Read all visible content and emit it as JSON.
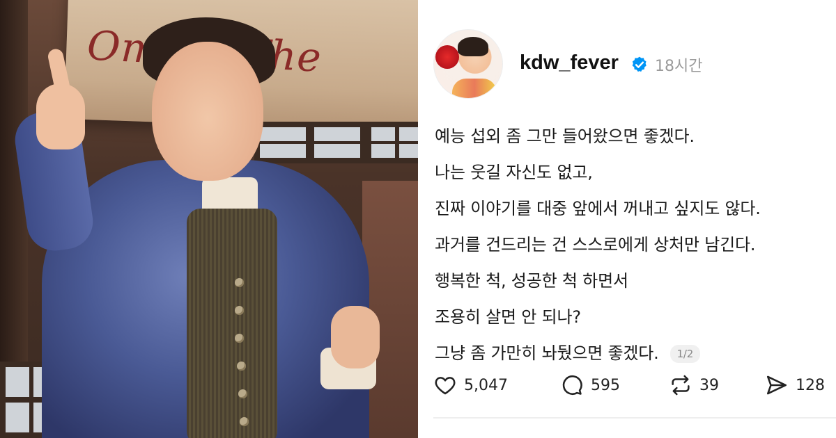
{
  "photo": {
    "banner_text": "Om   te: The"
  },
  "post": {
    "username": "kdw_fever",
    "time": "18시간",
    "lines": [
      "예능 섭외 좀 그만 들어왔으면 좋겠다.",
      "나는 웃길 자신도 없고,",
      "진짜 이야기를 대중 앞에서 꺼내고 싶지도 않다.",
      "과거를 건드리는 건 스스로에게 상처만 남긴다.",
      "행복한 척, 성공한 척 하면서",
      "조용히 살면 안 되나?",
      "그냥 좀 가만히 놔뒀으면 좋겠다."
    ],
    "page_indicator": "1/2",
    "actions": {
      "likes": "5,047",
      "comments": "595",
      "reposts": "39",
      "shares": "128"
    },
    "icons": {
      "like": "heart-icon",
      "comment": "comment-icon",
      "repost": "repost-icon",
      "share": "send-icon",
      "verified": "verified-badge-icon"
    },
    "colors": {
      "verified": "#0095f6",
      "time": "#9a9a9a"
    }
  }
}
